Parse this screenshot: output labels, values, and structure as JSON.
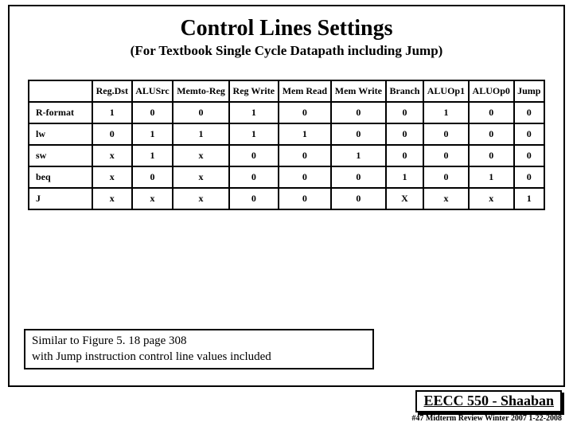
{
  "title": "Control Lines Settings",
  "subtitle": "(For Textbook Single Cycle Datapath including Jump)",
  "table": {
    "headers": [
      "Reg.Dst",
      "ALUSrc",
      "Memto-Reg",
      "Reg Write",
      "Mem Read",
      "Mem Write",
      "Branch",
      "ALUOp1",
      "ALUOp0",
      "Jump"
    ],
    "rows": [
      {
        "name": "R-format",
        "cells": [
          "1",
          "0",
          "0",
          "1",
          "0",
          "0",
          "0",
          "1",
          "0",
          "0"
        ]
      },
      {
        "name": "lw",
        "cells": [
          "0",
          "1",
          "1",
          "1",
          "1",
          "0",
          "0",
          "0",
          "0",
          "0"
        ]
      },
      {
        "name": "sw",
        "cells": [
          "x",
          "1",
          "x",
          "0",
          "0",
          "1",
          "0",
          "0",
          "0",
          "0"
        ]
      },
      {
        "name": "beq",
        "cells": [
          "x",
          "0",
          "x",
          "0",
          "0",
          "0",
          "1",
          "0",
          "1",
          "0"
        ]
      },
      {
        "name": "J",
        "cells": [
          "x",
          "x",
          "x",
          "0",
          "0",
          "0",
          "X",
          "x",
          "x",
          "1"
        ]
      }
    ]
  },
  "note_line1": "Similar to Figure 5. 18 page 308",
  "note_line2": "with Jump instruction control line values included",
  "footer_course": "EECC 550 - Shaaban",
  "footer_meta": "#47   Midterm Review  Winter 2007  1-22-2008"
}
